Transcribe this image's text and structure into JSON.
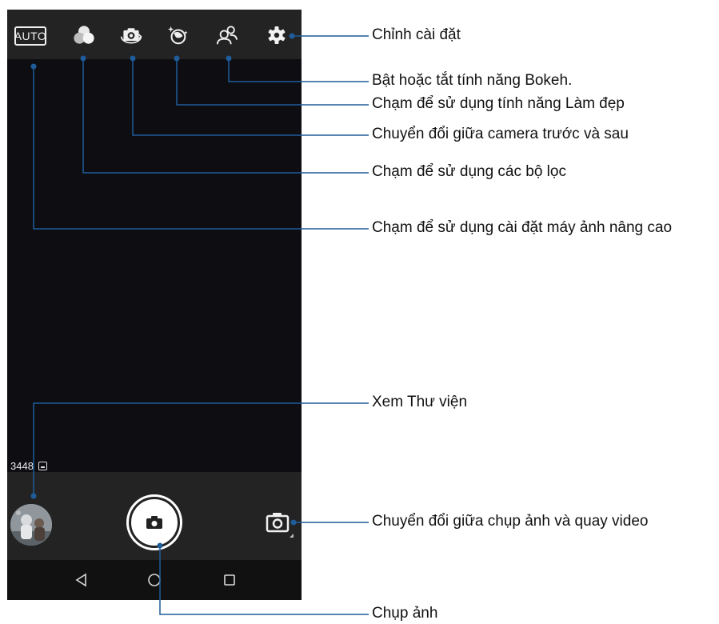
{
  "top_bar": {
    "auto_label": "AUTO",
    "icons": [
      "filter-icon",
      "camera-switch-icon",
      "beauty-icon",
      "bokeh-icon",
      "gear-icon"
    ]
  },
  "viewfinder": {
    "photo_count": "3448"
  },
  "bottom_bar": {
    "icons": [
      "gallery-thumbnail",
      "shutter-camera-icon",
      "photo-video-switch-icon"
    ]
  },
  "nav_bar": {
    "icons": [
      "back-triangle-icon",
      "home-circle-icon",
      "recents-square-icon"
    ]
  },
  "callouts": {
    "settings": "Chỉnh cài đặt",
    "bokeh": "Bật hoặc tắt tính năng Bokeh.",
    "beauty": "Chạm để sử dụng tính năng Làm đẹp",
    "switch_camera": "Chuyển đổi giữa camera trước và sau",
    "filters": "Chạm để sử dụng các bộ lọc",
    "advanced": "Chạm để sử dụng cài đặt máy ảnh nâng cao",
    "gallery": "Xem Thư viện",
    "photo_video": "Chuyển đổi giữa chụp ảnh và quay video",
    "capture": "Chụp ảnh"
  },
  "colors": {
    "callout_line": "#1f5c99",
    "bar_background": "#232323",
    "viewfinder": "#0d0d12"
  }
}
